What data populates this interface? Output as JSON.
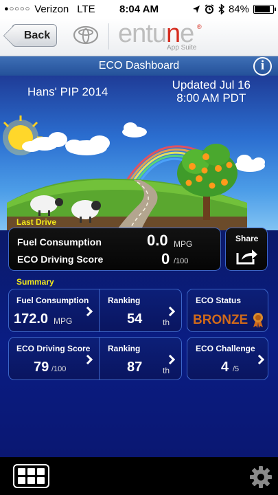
{
  "status_bar": {
    "signal": "●○○○○",
    "carrier": "Verizon",
    "network": "LTE",
    "time": "8:04 AM",
    "battery_percent": "84%",
    "battery_level": 0.84,
    "icons": [
      "location-arrow-icon",
      "alarm-icon",
      "bluetooth-icon",
      "battery-icon"
    ]
  },
  "header": {
    "back_label": "Back",
    "brand_logo": "toyota-logo",
    "app_logo": "entune",
    "app_suite": "App Suite"
  },
  "title_bar": {
    "title": "ECO Dashboard",
    "info": "i"
  },
  "scene": {
    "vehicle_name": "Hans' PIP 2014",
    "updated_line1": "Updated Jul 16",
    "updated_line2": "8:00 AM PDT"
  },
  "last_drive": {
    "section_label": "Last Drive",
    "fuel_label": "Fuel Consumption",
    "fuel_value": "0.0",
    "fuel_unit": "MPG",
    "score_label": "ECO Driving Score",
    "score_value": "0",
    "score_unit": "/100",
    "share_label": "Share"
  },
  "summary": {
    "section_label": "Summary",
    "fuel_label": "Fuel Consumption",
    "fuel_value": "172.0",
    "fuel_unit": "MPG",
    "fuel_ranking_label": "Ranking",
    "fuel_ranking_value": "54",
    "fuel_ranking_unit": "th",
    "eco_status_label": "ECO Status",
    "eco_status_value": "BRONZE",
    "score_label": "ECO Driving Score",
    "score_value": "79",
    "score_unit": "/100",
    "score_ranking_label": "Ranking",
    "score_ranking_value": "87",
    "score_ranking_unit": "th",
    "challenge_label": "ECO Challenge",
    "challenge_value": "4",
    "challenge_unit": "/5"
  },
  "colors": {
    "accent_yellow": "#f2e81b",
    "title_blue": "#2c5ba6",
    "panel_border": "#3d66c9",
    "bronze": "#d06a1a"
  }
}
